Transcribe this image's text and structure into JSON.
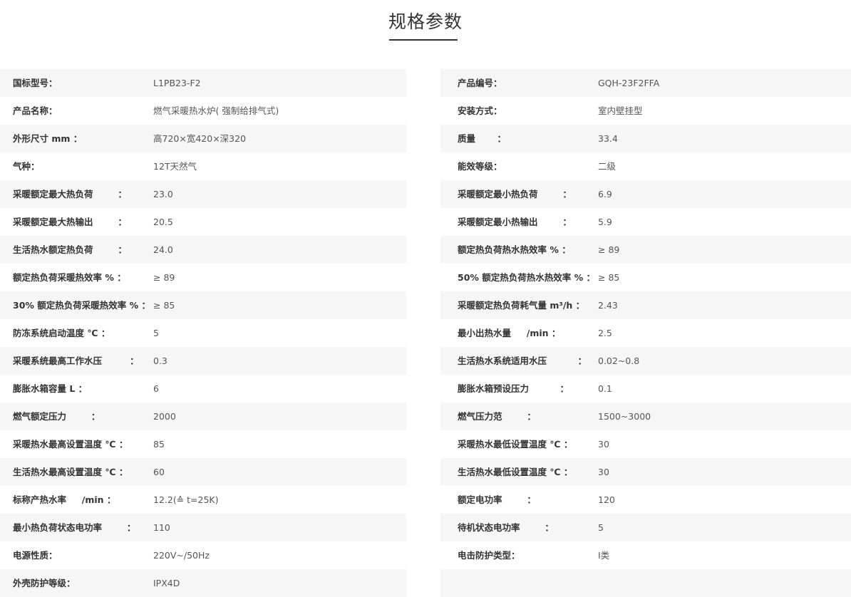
{
  "title": "规格参数",
  "left": [
    {
      "label": "国标型号：",
      "value": "L1PB23-F2"
    },
    {
      "label": "产品名称：",
      "value": "燃气采暖热水炉( 强制给排气式)"
    },
    {
      "label": "外形尺寸 mm ：",
      "value": "高720×宽420×深320"
    },
    {
      "label": "气种：",
      "value": "12T天然气"
    },
    {
      "label": "采暖额定最大热负荷        ：",
      "value": "23.0"
    },
    {
      "label": "采暖额定最大热输出        ：",
      "value": "20.5"
    },
    {
      "label": "生活热水额定热负荷        ：",
      "value": "24.0"
    },
    {
      "label": "额定热负荷采暖热效率 % ：",
      "value": "≥ 89"
    },
    {
      "label": "30% 额定热负荷采暖热效率 % ：",
      "value": "≥ 85"
    },
    {
      "label": "防冻系统启动温度 ℃ ：",
      "value": "5"
    },
    {
      "label": "采暖系统最高工作水压         ：",
      "value": "0.3"
    },
    {
      "label": "膨胀水箱容量 L ：",
      "value": "6"
    },
    {
      "label": "燃气额定压力        ：",
      "value": "2000"
    },
    {
      "label": "采暖热水最高设置温度 ℃ ：",
      "value": "85"
    },
    {
      "label": "生活热水最高设置温度 ℃ ：",
      "value": "60"
    },
    {
      "label": "标称产热水率     /min ：",
      "value": "12.2(≙ t=25K)"
    },
    {
      "label": "最小热负荷状态电功率        ：",
      "value": "110"
    },
    {
      "label": "电源性质：",
      "value": "220V~/50Hz"
    },
    {
      "label": "外壳防护等级：",
      "value": "IPX4D"
    }
  ],
  "right": [
    {
      "label": "产品编号：",
      "value": "GQH-23F2FFA"
    },
    {
      "label": "安装方式：",
      "value": "室内壁挂型"
    },
    {
      "label": "质量       ：",
      "value": "33.4"
    },
    {
      "label": "能效等级：",
      "value": "二级"
    },
    {
      "label": "采暖额定最小热负荷        ：",
      "value": "6.9"
    },
    {
      "label": "采暖额定最小热输出        ：",
      "value": "5.9"
    },
    {
      "label": "额定热负荷热水热效率 % ：",
      "value": "≥ 89"
    },
    {
      "label": "50% 额定热负荷热水热效率 % ：",
      "value": "≥ 85"
    },
    {
      "label": "采暖额定热负荷耗气量 m³/h ：",
      "value": "2.43"
    },
    {
      "label": "最小出热水量     /min ：",
      "value": "2.5"
    },
    {
      "label": "生活热水系统适用水压          ：",
      "value": "0.02~0.8"
    },
    {
      "label": "膨胀水箱预设压力          ：",
      "value": "0.1"
    },
    {
      "label": "燃气压力范        ：",
      "value": "1500~3000"
    },
    {
      "label": "采暖热水最低设置温度 ℃ ：",
      "value": "30"
    },
    {
      "label": "生活热水最低设置温度 ℃ ：",
      "value": "30"
    },
    {
      "label": "额定电功率        ：",
      "value": "120"
    },
    {
      "label": "待机状态电功率        ：",
      "value": "5"
    },
    {
      "label": "电击防护类型：",
      "value": "Ⅰ类"
    },
    {
      "label": "",
      "value": ""
    }
  ]
}
